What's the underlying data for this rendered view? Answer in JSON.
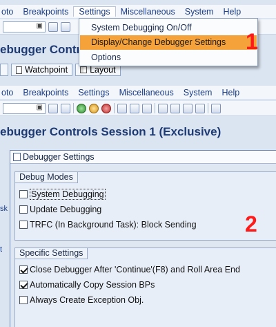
{
  "back_window": {
    "menu": [
      "oto",
      "Breakpoints",
      "Settings",
      "Miscellaneous",
      "System",
      "Help"
    ],
    "title_fragment": "ebugger Contr",
    "tabs": [
      "Watchpoint",
      "Layout"
    ]
  },
  "dropdown": {
    "items": [
      {
        "label": "System Debugging On/Off"
      },
      {
        "label": "Display/Change Debugger Settings"
      },
      {
        "label": "Options"
      }
    ]
  },
  "front_window": {
    "menu": [
      "oto",
      "Breakpoints",
      "Settings",
      "Miscellaneous",
      "System",
      "Help"
    ],
    "title": "ebugger Controls Session 1 (Exclusive)"
  },
  "dialog": {
    "title": "Debugger Settings",
    "debug_modes": {
      "title": "Debug Modes",
      "options": [
        {
          "label": "System Debugging",
          "checked": false
        },
        {
          "label": "Update Debugging",
          "checked": false
        },
        {
          "label": "TRFC (In Background Task): Block Sending",
          "checked": false
        }
      ]
    },
    "specific_settings": {
      "title": "Specific Settings",
      "options": [
        {
          "label": "Close Debugger After 'Continue'(F8) and Roll Area End",
          "checked": true
        },
        {
          "label": "Automatically Copy Session BPs",
          "checked": true
        },
        {
          "label": "Always Create Exception Obj.",
          "checked": false
        }
      ]
    }
  },
  "markers": {
    "step1": "1",
    "step2": "2"
  },
  "side_fragments": {
    "left1": "sk",
    "left2": "t"
  },
  "colors": {
    "highlight": "#f6a23a",
    "marker": "#ff1a1a",
    "title": "#1e3a72"
  }
}
